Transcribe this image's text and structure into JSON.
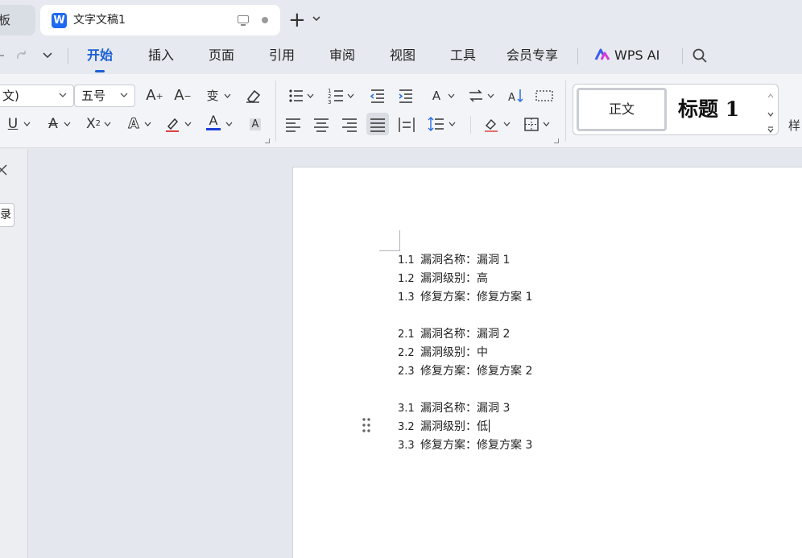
{
  "tabs": {
    "prev_tab_label": "板",
    "active_doc_title": "文字文稿1",
    "doc_icon_letter": "W",
    "new_tab_label": "+"
  },
  "menu": {
    "items": [
      "开始",
      "插入",
      "页面",
      "引用",
      "审阅",
      "视图",
      "工具",
      "会员专享"
    ],
    "active": "开始",
    "wps_ai": "WPS AI"
  },
  "ribbon": {
    "font_name": "文)",
    "font_size": "五号",
    "styles": {
      "normal": "正文",
      "heading1": "标题 1",
      "more_label": "样"
    }
  },
  "sidebar": {
    "button_label": "录"
  },
  "document": {
    "lines": [
      {
        "num": "1.1",
        "text": "漏洞名称：漏洞 1"
      },
      {
        "num": "1.2",
        "text": "漏洞级别：高"
      },
      {
        "num": "1.3",
        "text": "修复方案：修复方案 1"
      },
      {
        "num": "",
        "text": ""
      },
      {
        "num": "2.1",
        "text": "漏洞名称：漏洞 2"
      },
      {
        "num": "2.2",
        "text": "漏洞级别：中"
      },
      {
        "num": "2.3",
        "text": "修复方案：修复方案 2"
      },
      {
        "num": "",
        "text": ""
      },
      {
        "num": "3.1",
        "text": "漏洞名称：漏洞 3"
      },
      {
        "num": "3.2",
        "text": "漏洞级别：低"
      },
      {
        "num": "3.3",
        "text": "修复方案：修复方案 3"
      }
    ],
    "cursor_line": 9
  },
  "colors": {
    "accent": "#1a5fd6",
    "font_color_bar": "#1f3fd8"
  }
}
